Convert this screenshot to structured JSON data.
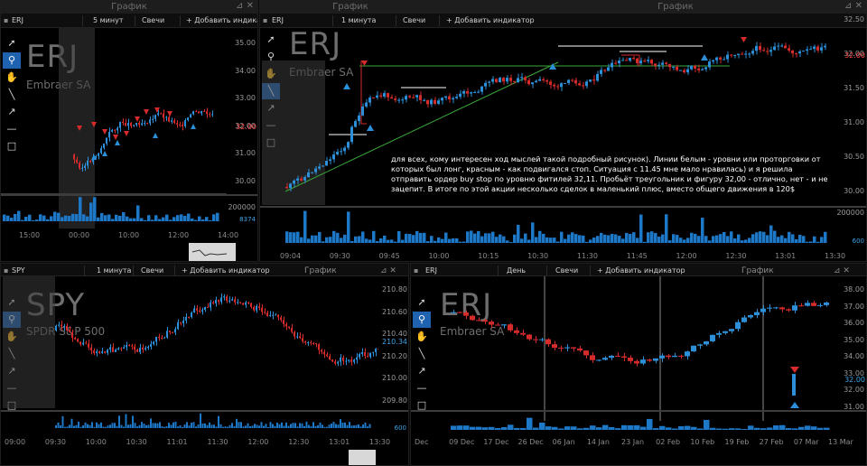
{
  "colors": {
    "up": "#2d8fd8",
    "down": "#d62b2b",
    "volume": "#1e78c8",
    "accent": "#1f63b0",
    "level_line": "#ffffff",
    "trend_line": "#3aa83a"
  },
  "tool_icons": [
    "cursor-icon",
    "zoom-icon",
    "hand-icon",
    "line-icon",
    "arrow-icon",
    "hline-icon",
    "rect-icon"
  ],
  "panels": [
    {
      "key": "p1",
      "window_title": "График",
      "symbol": "ERJ",
      "interval": "5 минут",
      "chart_type": "Свечи",
      "add_indicator": "+ Добавить индикатор",
      "watermark_symbol": "ERJ",
      "watermark_name": "Embraer SA",
      "price_ticks": [
        "35.00",
        "34.00",
        "33.00",
        "32.00",
        "31.00",
        "30.00"
      ],
      "last_price": "32.00",
      "volume_label": "200000",
      "volume_value": "8374",
      "time_ticks": [
        "15:00",
        "00:00",
        "10:00",
        "12:00",
        "14:00"
      ]
    },
    {
      "key": "p2",
      "window_title": "График",
      "window_title_secondary": "График",
      "symbol": "ERJ",
      "interval": "1 минута",
      "chart_type": "Свечи",
      "add_indicator": "+ Добавить индикатор",
      "watermark_symbol": "ERJ",
      "watermark_name": "Embraer SA",
      "price_ticks": [
        "32.50",
        "32.00",
        "31.50",
        "31.00",
        "30.50",
        "30.00"
      ],
      "last_price": "32.00",
      "volume_label": "200000",
      "volume_value": "600",
      "time_ticks": [
        "09:04",
        "09:30",
        "09:45",
        "10:00",
        "10:15",
        "10:30",
        "11:30",
        "11:45",
        "12:00",
        "12:30",
        "13:01",
        "13:30"
      ],
      "note": "для всех, кому интересен ход мыслей такой подробный рисунок). Линии белым - уровни или проторговки от которых был лонг, красным - как подвигался стоп. Ситуация с 11.45 мне мало нравилась) и я решила отправить ордер buy stop по уровню фитилей 32,11. Пробьёт треугольник и фигуру 32,00 - отлично, нет - и не зацепит. В итоге по этой акции несколько сделок в маленький плюс, вместо общего движения в 120$"
    },
    {
      "key": "p3",
      "window_title": "График",
      "symbol": "SPY",
      "interval": "1 минута",
      "chart_type": "Свечи",
      "add_indicator": "+ Добавить индикатор",
      "watermark_symbol": "SPY",
      "watermark_name": "SPDR S&P 500",
      "price_ticks": [
        "210.80",
        "210.60",
        "210.40",
        "210.20",
        "210.00",
        "209.80"
      ],
      "last_price": "210.34",
      "volume_value": "600",
      "time_ticks": [
        "09:00",
        "09:30",
        "10:00",
        "10:30",
        "11:01",
        "11:30",
        "12:00",
        "12:30",
        "13:01",
        "13:30"
      ]
    },
    {
      "key": "p4",
      "window_title": "График",
      "symbol": "ERJ",
      "interval": "День",
      "chart_type": "Свечи",
      "add_indicator": "+ Добавить индикатор",
      "watermark_symbol": "ERJ",
      "watermark_name": "Embraer SA",
      "price_ticks": [
        "38.00",
        "37.00",
        "36.00",
        "35.00",
        "34.00",
        "33.00",
        "32.00",
        "31.00"
      ],
      "last_price": "32.00",
      "time_ticks": [
        "Dec",
        "09 Dec",
        "17 Dec",
        "26 Dec",
        "06 Jan",
        "14 Jan",
        "23 Jan",
        "02 Feb",
        "10 Feb",
        "19 Feb",
        "27 Feb",
        "07 Mar",
        "13 Mar"
      ]
    }
  ]
}
